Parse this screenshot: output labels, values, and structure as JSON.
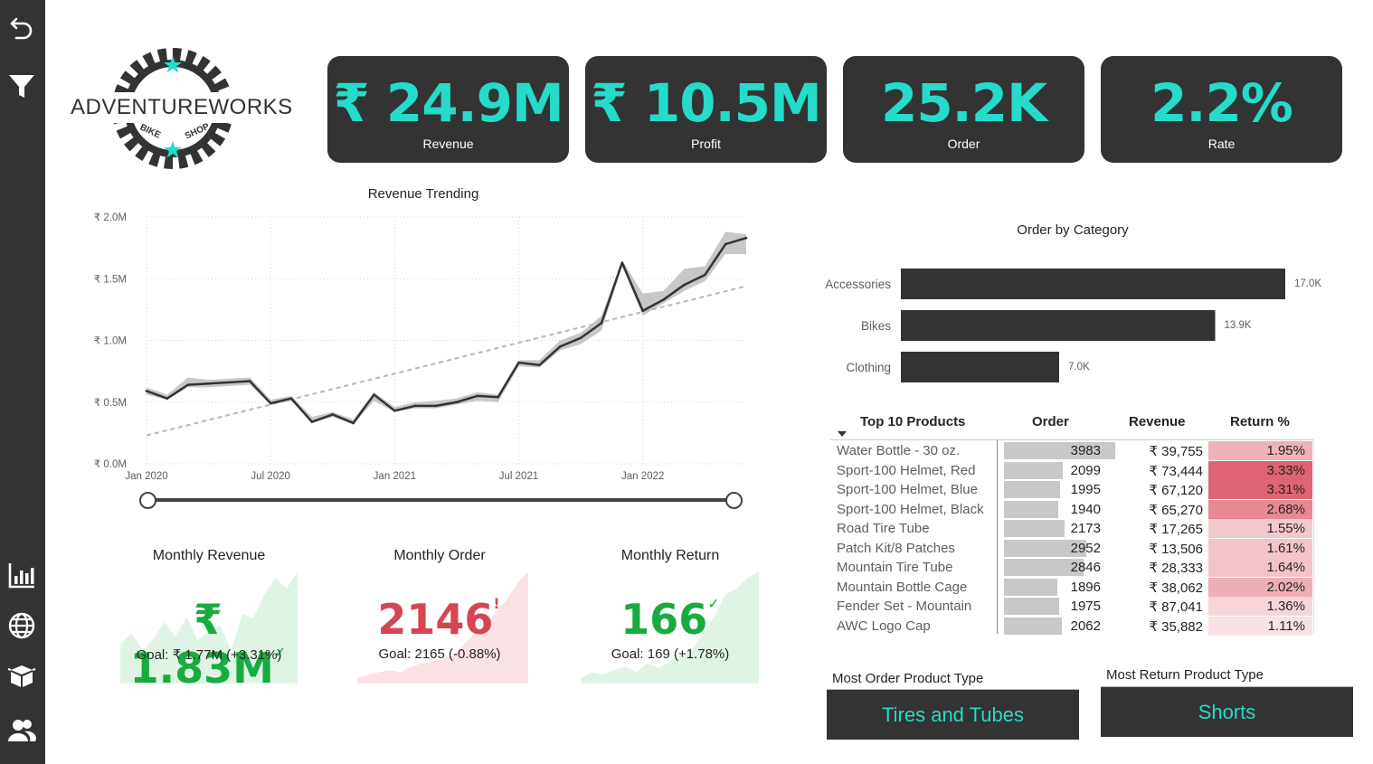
{
  "logo": {
    "brand": "ADVENTUREWORKS",
    "bike": "BIKE",
    "shop": "SHOP"
  },
  "sidebar": {
    "icons": [
      "back-icon",
      "filter-icon",
      "bar-chart-icon",
      "globe-icon",
      "box-icon",
      "users-icon"
    ]
  },
  "kpis": [
    {
      "value": "₹ 24.9M",
      "label": "Revenue"
    },
    {
      "value": "₹ 10.5M",
      "label": "Profit"
    },
    {
      "value": "25.2K",
      "label": "Order"
    },
    {
      "value": "2.2%",
      "label": "Rate"
    }
  ],
  "colors": {
    "accent": "#25dbc9",
    "dark": "#333333",
    "good": "#1aab40",
    "bad": "#d64554",
    "bar": "#333333"
  },
  "chart_data": [
    {
      "type": "line",
      "title": "Revenue Trending",
      "x_ticks": [
        "Jan 2020",
        "Jul 2020",
        "Jan 2021",
        "Jul 2021",
        "Jan 2022"
      ],
      "y_ticks": [
        "₹ 0.0M",
        "₹ 0.5M",
        "₹ 1.0M",
        "₹ 1.5M",
        "₹ 2.0M"
      ],
      "ylim": [
        0,
        2.0
      ],
      "y_unit": "₹ M",
      "x": [
        "2020-01",
        "2020-02",
        "2020-03",
        "2020-04",
        "2020-05",
        "2020-06",
        "2020-07",
        "2020-08",
        "2020-09",
        "2020-10",
        "2020-11",
        "2020-12",
        "2021-01",
        "2021-02",
        "2021-03",
        "2021-04",
        "2021-05",
        "2021-06",
        "2021-07",
        "2021-08",
        "2021-09",
        "2021-10",
        "2021-11",
        "2021-12",
        "2022-01",
        "2022-02",
        "2022-03",
        "2022-04",
        "2022-05",
        "2022-06"
      ],
      "series": [
        {
          "values": [
            0.59,
            0.53,
            0.64,
            0.65,
            0.66,
            0.67,
            0.49,
            0.53,
            0.34,
            0.4,
            0.33,
            0.56,
            0.43,
            0.47,
            0.47,
            0.5,
            0.55,
            0.54,
            0.82,
            0.8,
            0.95,
            1.02,
            1.14,
            1.63,
            1.24,
            1.33,
            1.45,
            1.53,
            1.78,
            1.83
          ]
        }
      ],
      "band_low": [
        0.56,
        0.52,
        0.62,
        0.62,
        0.63,
        0.64,
        0.48,
        0.51,
        0.33,
        0.38,
        0.32,
        0.51,
        0.42,
        0.45,
        0.45,
        0.48,
        0.51,
        0.5,
        0.79,
        0.78,
        0.92,
        0.97,
        1.08,
        1.6,
        1.2,
        1.3,
        1.4,
        1.48,
        1.7,
        1.7
      ],
      "band_high": [
        0.62,
        0.56,
        0.7,
        0.68,
        0.69,
        0.7,
        0.52,
        0.55,
        0.38,
        0.42,
        0.36,
        0.58,
        0.46,
        0.5,
        0.51,
        0.53,
        0.58,
        0.56,
        0.84,
        0.84,
        1.0,
        1.06,
        1.2,
        1.65,
        1.38,
        1.4,
        1.58,
        1.6,
        1.88,
        1.86
      ],
      "trend": [
        0.23,
        1.44
      ],
      "grid": true
    },
    {
      "type": "bar",
      "orientation": "horizontal",
      "title": "Order by Category",
      "categories": [
        "Accessories",
        "Bikes",
        "Clothing"
      ],
      "values": [
        17.0,
        13.9,
        7.0
      ],
      "labels": [
        "17.0K",
        "13.9K",
        "7.0K"
      ],
      "xlim": [
        0,
        17.0
      ]
    },
    {
      "type": "area",
      "title": "Monthly Revenue",
      "values": [
        0.35,
        0.45,
        0.3,
        0.4,
        0.55,
        0.42,
        0.6,
        0.38,
        0.48,
        0.52,
        0.3,
        0.62,
        0.58,
        0.8,
        0.95,
        0.85,
        1.0
      ],
      "value": "₹ 1.83M",
      "goal": "Goal: ₹ 1.77M (+3.31%)",
      "status": "good"
    },
    {
      "type": "area",
      "title": "Monthly Order",
      "values": [
        0.05,
        0.08,
        0.1,
        0.12,
        0.1,
        0.15,
        0.18,
        0.2,
        0.22,
        0.25,
        0.35,
        0.45,
        0.5,
        0.65,
        0.75,
        0.9,
        1.0
      ],
      "value": "2146",
      "goal": "Goal: 2165 (-0.88%)",
      "status": "bad"
    },
    {
      "type": "area",
      "title": "Monthly Return",
      "values": [
        0.05,
        0.1,
        0.08,
        0.12,
        0.15,
        0.1,
        0.18,
        0.14,
        0.2,
        0.25,
        0.3,
        0.45,
        0.6,
        0.8,
        0.85,
        0.95,
        1.0
      ],
      "value": "166",
      "goal": "Goal: 169 (+1.78%)",
      "status": "good"
    }
  ],
  "kpi_icons": {
    "good": "✓",
    "bad": "!"
  },
  "table": {
    "headers": [
      "Top 10 Products",
      "Order",
      "Revenue",
      "Return %"
    ],
    "rows": [
      {
        "name": "Water Bottle - 30 oz.",
        "order": "3983",
        "order_val": 3983,
        "revenue": "₹ 39,755",
        "ret": "1.95%",
        "ret_val": 1.95
      },
      {
        "name": "Sport-100 Helmet, Red",
        "order": "2099",
        "order_val": 2099,
        "revenue": "₹ 73,444",
        "ret": "3.33%",
        "ret_val": 3.33
      },
      {
        "name": "Sport-100 Helmet, Blue",
        "order": "1995",
        "order_val": 1995,
        "revenue": "₹ 67,120",
        "ret": "3.31%",
        "ret_val": 3.31
      },
      {
        "name": "Sport-100 Helmet, Black",
        "order": "1940",
        "order_val": 1940,
        "revenue": "₹ 65,270",
        "ret": "2.68%",
        "ret_val": 2.68
      },
      {
        "name": "Road Tire Tube",
        "order": "2173",
        "order_val": 2173,
        "revenue": "₹ 17,265",
        "ret": "1.55%",
        "ret_val": 1.55
      },
      {
        "name": "Patch Kit/8 Patches",
        "order": "2952",
        "order_val": 2952,
        "revenue": "₹ 13,506",
        "ret": "1.61%",
        "ret_val": 1.61
      },
      {
        "name": "Mountain Tire Tube",
        "order": "2846",
        "order_val": 2846,
        "revenue": "₹ 28,333",
        "ret": "1.64%",
        "ret_val": 1.64
      },
      {
        "name": "Mountain Bottle Cage",
        "order": "1896",
        "order_val": 1896,
        "revenue": "₹ 38,062",
        "ret": "2.02%",
        "ret_val": 2.02
      },
      {
        "name": "Fender Set - Mountain",
        "order": "1975",
        "order_val": 1975,
        "revenue": "₹ 87,041",
        "ret": "1.36%",
        "ret_val": 1.36
      },
      {
        "name": "AWC Logo Cap",
        "order": "2062",
        "order_val": 2062,
        "revenue": "₹ 35,882",
        "ret": "1.11%",
        "ret_val": 1.11
      }
    ]
  },
  "most": {
    "order_label": "Most Order Product Type",
    "order_value": "Tires and Tubes",
    "return_label": "Most Return Product Type",
    "return_value": "Shorts"
  }
}
